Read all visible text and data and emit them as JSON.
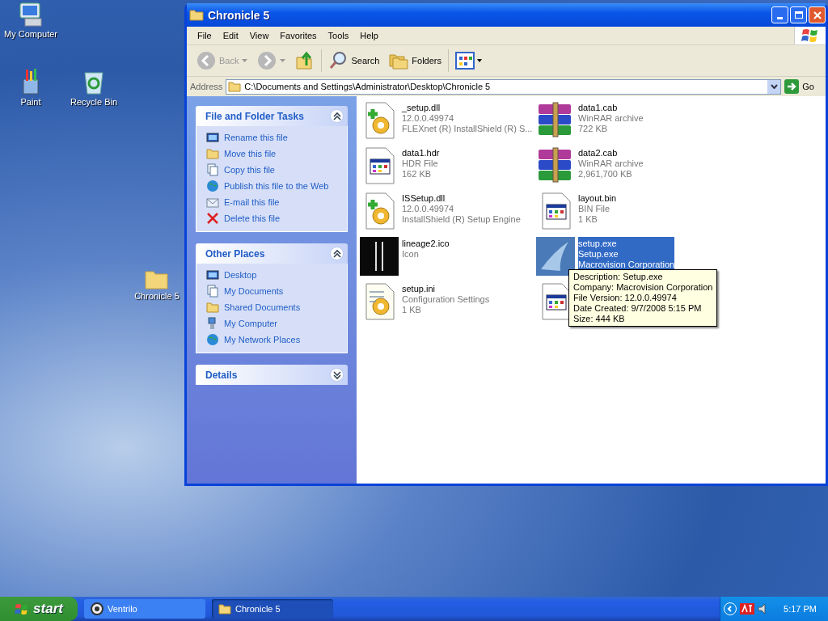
{
  "desktop_icons": [
    {
      "label": "My Computer",
      "kind": "computer"
    },
    {
      "label": "Paint",
      "kind": "paint"
    },
    {
      "label": "Recycle Bin",
      "kind": "recycle"
    },
    {
      "label": "Chronicle 5",
      "kind": "folder"
    }
  ],
  "window": {
    "title": "Chronicle 5",
    "menu": [
      "File",
      "Edit",
      "View",
      "Favorites",
      "Tools",
      "Help"
    ],
    "toolbar": [
      {
        "label": "Back",
        "kind": "back",
        "disabled": true
      },
      {
        "kind": "forward",
        "disabled": true
      },
      {
        "kind": "up"
      },
      {
        "label": "Search",
        "kind": "search"
      },
      {
        "label": "Folders",
        "kind": "folders"
      },
      {
        "kind": "views"
      }
    ],
    "address": {
      "label": "Address",
      "value": "C:\\Documents and Settings\\Administrator\\Desktop\\Chronicle 5",
      "go": "Go"
    },
    "panels": [
      {
        "title": "File and Folder Tasks",
        "expanded": true,
        "items": [
          {
            "label": "Rename this file",
            "kind": "rename"
          },
          {
            "label": "Move this file",
            "kind": "move"
          },
          {
            "label": "Copy this file",
            "kind": "copy"
          },
          {
            "label": "Publish this file to the Web",
            "kind": "publish"
          },
          {
            "label": "E-mail this file",
            "kind": "email"
          },
          {
            "label": "Delete this file",
            "kind": "delete"
          }
        ]
      },
      {
        "title": "Other Places",
        "expanded": true,
        "items": [
          {
            "label": "Desktop",
            "kind": "desktop"
          },
          {
            "label": "My Documents",
            "kind": "documents"
          },
          {
            "label": "Shared Documents",
            "kind": "folder"
          },
          {
            "label": "My Computer",
            "kind": "computer"
          },
          {
            "label": "My Network Places",
            "kind": "network"
          }
        ]
      },
      {
        "title": "Details",
        "expanded": false
      }
    ],
    "files": [
      {
        "name": "_setup.dll",
        "details": [
          "12.0.0.49974",
          "FLEXnet (R) InstallShield (R) S..."
        ],
        "kind": "dll",
        "selected": false
      },
      {
        "name": "data1.cab",
        "details": [
          "WinRAR archive",
          "722 KB"
        ],
        "kind": "archive",
        "selected": false
      },
      {
        "name": "data1.hdr",
        "details": [
          "HDR File",
          "162 KB"
        ],
        "kind": "generic",
        "selected": false
      },
      {
        "name": "data2.cab",
        "details": [
          "WinRAR archive",
          "2,961,700 KB"
        ],
        "kind": "archive",
        "selected": false
      },
      {
        "name": "ISSetup.dll",
        "details": [
          "12.0.0.49974",
          "InstallShield (R) Setup Engine"
        ],
        "kind": "dll",
        "selected": false
      },
      {
        "name": "layout.bin",
        "details": [
          "BIN File",
          "1 KB"
        ],
        "kind": "generic",
        "selected": false
      },
      {
        "name": "lineage2.ico",
        "details": [
          "Icon"
        ],
        "kind": "lineage",
        "selected": false
      },
      {
        "name": "setup.exe",
        "details": [
          "Setup.exe",
          "Macrovision Corporation"
        ],
        "kind": "installer",
        "selected": true
      },
      {
        "name": "setup.ini",
        "details": [
          "Configuration Settings",
          "1 KB"
        ],
        "kind": "ini",
        "selected": false
      },
      {
        "kind": "generic"
      }
    ],
    "tooltip": [
      "Description: Setup.exe",
      "Company: Macrovision Corporation",
      "File Version: 12.0.0.49974",
      "Date Created: 9/7/2008 5:15 PM",
      "Size: 444 KB"
    ]
  },
  "taskbar": {
    "start": "start",
    "tasks": [
      {
        "label": "Ventrilo",
        "kind": "ventrilo",
        "selected": false
      },
      {
        "label": "Chronicle 5",
        "kind": "folder",
        "selected": true
      }
    ],
    "clock": "5:17 PM"
  }
}
